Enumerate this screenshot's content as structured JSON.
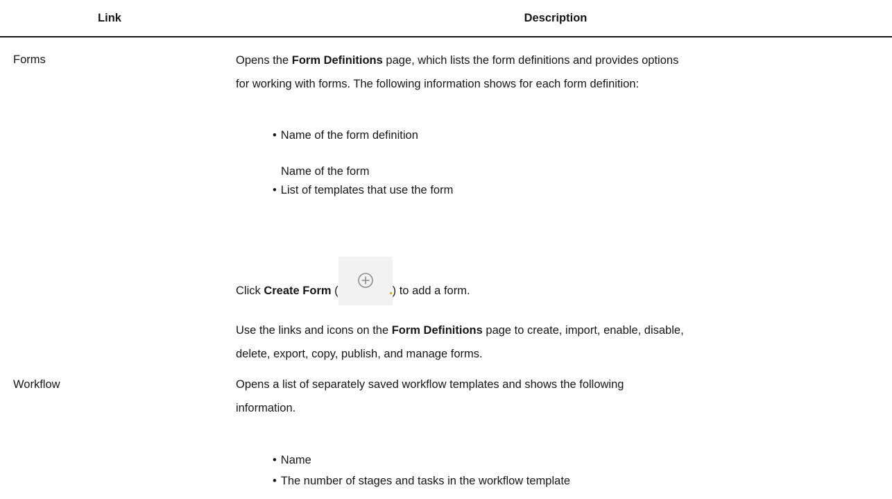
{
  "header": {
    "link": "Link",
    "description": "Description"
  },
  "rows": [
    {
      "link": "Forms",
      "desc_line1_pre": "Opens the ",
      "desc_line1_bold": "Form Definitions",
      "desc_line1_post": " page, which lists the form definitions and provides options",
      "desc_line2": "for working with forms. The following information shows for each form definition:",
      "bullet_1": "Name of the form definition",
      "subnote": "Name of the form",
      "bullet_2": "List of templates that use the form",
      "click_pre": "Click ",
      "click_bold": "Create Form",
      "click_open": " (",
      "click_post": ") to add a form.",
      "create_icon": "plus-circle-icon",
      "use_line1_pre": "Use the links and icons on the ",
      "use_line1_bold": "Form Definitions",
      "use_line1_post": " page to create, import, enable, disable,",
      "use_line2": "delete, export, copy, publish, and manage forms."
    },
    {
      "link": "Workflow",
      "desc_line1": "Opens a list of separately saved workflow templates and shows the following",
      "desc_line2": "information.",
      "bullet_1": "Name",
      "bullet_2": "The number of stages and tasks in the workflow template"
    }
  ],
  "colors": {
    "text": "#161616",
    "icon_bg": "#f2f2f2",
    "icon_stroke": "#8d8d8d"
  }
}
